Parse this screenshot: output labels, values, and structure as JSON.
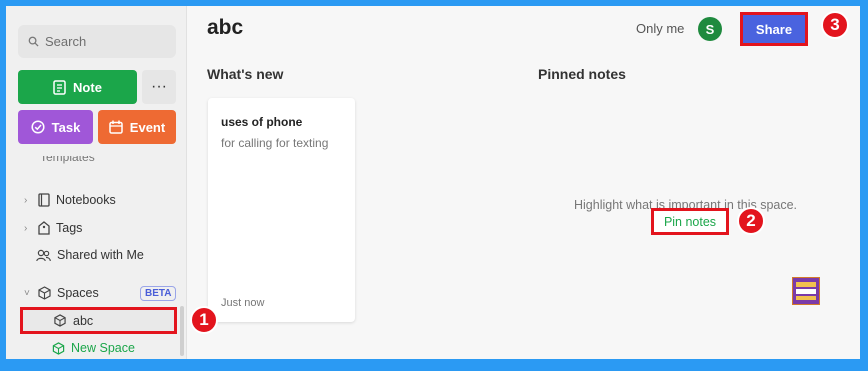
{
  "sidebar": {
    "search_placeholder": "Search",
    "note_label": "Note",
    "more_label": "···",
    "task_label": "Task",
    "event_label": "Event",
    "templates_label": "Templates",
    "items": [
      {
        "label": "Notebooks"
      },
      {
        "label": "Tags"
      },
      {
        "label": "Shared with Me"
      },
      {
        "label": "Spaces"
      }
    ],
    "beta_label": "BETA",
    "space_label": "abc",
    "new_space_label": "New Space"
  },
  "header": {
    "title": "abc",
    "visibility": "Only me",
    "avatar_initial": "S",
    "share_label": "Share"
  },
  "whats_new": {
    "heading": "What's new",
    "card": {
      "title": "uses of phone",
      "body": "for calling for texting",
      "time": "Just now"
    }
  },
  "pinned": {
    "heading": "Pinned notes",
    "message": "Highlight what is important in this space.",
    "pin_label": "Pin notes"
  },
  "annotations": [
    "1",
    "2",
    "3"
  ],
  "colors": {
    "note_green": "#1ba64a",
    "task_purple": "#a057d8",
    "event_orange": "#ee6a33",
    "share_blue": "#4a63df",
    "highlight_red": "#e3141d",
    "frame_blue": "#2b9af3"
  }
}
